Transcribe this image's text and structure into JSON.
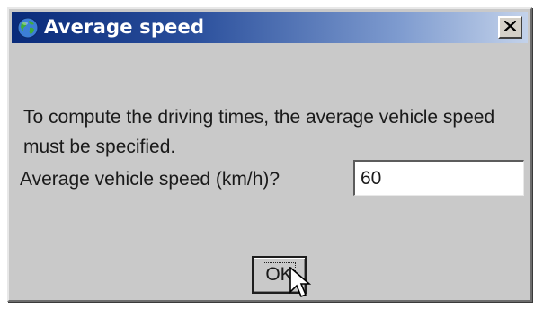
{
  "window": {
    "title": "Average speed",
    "icon": "globe-icon",
    "close_icon": "close-icon"
  },
  "message": {
    "text": "To compute the driving times, the average vehicle speed must be specified."
  },
  "speed_field": {
    "label": "Average vehicle speed (km/h)?",
    "value": "60"
  },
  "buttons": {
    "ok_label": "OK"
  },
  "colors": {
    "dialog_background": "#c9c9c9",
    "title_gradient_start": "#0a2b7a",
    "title_gradient_end": "#c3d2ea",
    "title_text": "#ffffff"
  }
}
